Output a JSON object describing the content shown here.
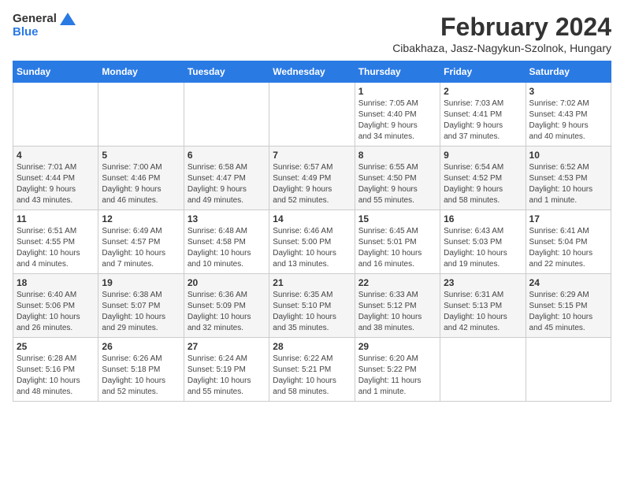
{
  "header": {
    "logo_general": "General",
    "logo_blue": "Blue",
    "month_year": "February 2024",
    "location": "Cibakhaza, Jasz-Nagykun-Szolnok, Hungary"
  },
  "weekdays": [
    "Sunday",
    "Monday",
    "Tuesday",
    "Wednesday",
    "Thursday",
    "Friday",
    "Saturday"
  ],
  "weeks": [
    [
      {
        "day": "",
        "info": ""
      },
      {
        "day": "",
        "info": ""
      },
      {
        "day": "",
        "info": ""
      },
      {
        "day": "",
        "info": ""
      },
      {
        "day": "1",
        "info": "Sunrise: 7:05 AM\nSunset: 4:40 PM\nDaylight: 9 hours\nand 34 minutes."
      },
      {
        "day": "2",
        "info": "Sunrise: 7:03 AM\nSunset: 4:41 PM\nDaylight: 9 hours\nand 37 minutes."
      },
      {
        "day": "3",
        "info": "Sunrise: 7:02 AM\nSunset: 4:43 PM\nDaylight: 9 hours\nand 40 minutes."
      }
    ],
    [
      {
        "day": "4",
        "info": "Sunrise: 7:01 AM\nSunset: 4:44 PM\nDaylight: 9 hours\nand 43 minutes."
      },
      {
        "day": "5",
        "info": "Sunrise: 7:00 AM\nSunset: 4:46 PM\nDaylight: 9 hours\nand 46 minutes."
      },
      {
        "day": "6",
        "info": "Sunrise: 6:58 AM\nSunset: 4:47 PM\nDaylight: 9 hours\nand 49 minutes."
      },
      {
        "day": "7",
        "info": "Sunrise: 6:57 AM\nSunset: 4:49 PM\nDaylight: 9 hours\nand 52 minutes."
      },
      {
        "day": "8",
        "info": "Sunrise: 6:55 AM\nSunset: 4:50 PM\nDaylight: 9 hours\nand 55 minutes."
      },
      {
        "day": "9",
        "info": "Sunrise: 6:54 AM\nSunset: 4:52 PM\nDaylight: 9 hours\nand 58 minutes."
      },
      {
        "day": "10",
        "info": "Sunrise: 6:52 AM\nSunset: 4:53 PM\nDaylight: 10 hours\nand 1 minute."
      }
    ],
    [
      {
        "day": "11",
        "info": "Sunrise: 6:51 AM\nSunset: 4:55 PM\nDaylight: 10 hours\nand 4 minutes."
      },
      {
        "day": "12",
        "info": "Sunrise: 6:49 AM\nSunset: 4:57 PM\nDaylight: 10 hours\nand 7 minutes."
      },
      {
        "day": "13",
        "info": "Sunrise: 6:48 AM\nSunset: 4:58 PM\nDaylight: 10 hours\nand 10 minutes."
      },
      {
        "day": "14",
        "info": "Sunrise: 6:46 AM\nSunset: 5:00 PM\nDaylight: 10 hours\nand 13 minutes."
      },
      {
        "day": "15",
        "info": "Sunrise: 6:45 AM\nSunset: 5:01 PM\nDaylight: 10 hours\nand 16 minutes."
      },
      {
        "day": "16",
        "info": "Sunrise: 6:43 AM\nSunset: 5:03 PM\nDaylight: 10 hours\nand 19 minutes."
      },
      {
        "day": "17",
        "info": "Sunrise: 6:41 AM\nSunset: 5:04 PM\nDaylight: 10 hours\nand 22 minutes."
      }
    ],
    [
      {
        "day": "18",
        "info": "Sunrise: 6:40 AM\nSunset: 5:06 PM\nDaylight: 10 hours\nand 26 minutes."
      },
      {
        "day": "19",
        "info": "Sunrise: 6:38 AM\nSunset: 5:07 PM\nDaylight: 10 hours\nand 29 minutes."
      },
      {
        "day": "20",
        "info": "Sunrise: 6:36 AM\nSunset: 5:09 PM\nDaylight: 10 hours\nand 32 minutes."
      },
      {
        "day": "21",
        "info": "Sunrise: 6:35 AM\nSunset: 5:10 PM\nDaylight: 10 hours\nand 35 minutes."
      },
      {
        "day": "22",
        "info": "Sunrise: 6:33 AM\nSunset: 5:12 PM\nDaylight: 10 hours\nand 38 minutes."
      },
      {
        "day": "23",
        "info": "Sunrise: 6:31 AM\nSunset: 5:13 PM\nDaylight: 10 hours\nand 42 minutes."
      },
      {
        "day": "24",
        "info": "Sunrise: 6:29 AM\nSunset: 5:15 PM\nDaylight: 10 hours\nand 45 minutes."
      }
    ],
    [
      {
        "day": "25",
        "info": "Sunrise: 6:28 AM\nSunset: 5:16 PM\nDaylight: 10 hours\nand 48 minutes."
      },
      {
        "day": "26",
        "info": "Sunrise: 6:26 AM\nSunset: 5:18 PM\nDaylight: 10 hours\nand 52 minutes."
      },
      {
        "day": "27",
        "info": "Sunrise: 6:24 AM\nSunset: 5:19 PM\nDaylight: 10 hours\nand 55 minutes."
      },
      {
        "day": "28",
        "info": "Sunrise: 6:22 AM\nSunset: 5:21 PM\nDaylight: 10 hours\nand 58 minutes."
      },
      {
        "day": "29",
        "info": "Sunrise: 6:20 AM\nSunset: 5:22 PM\nDaylight: 11 hours\nand 1 minute."
      },
      {
        "day": "",
        "info": ""
      },
      {
        "day": "",
        "info": ""
      }
    ]
  ]
}
